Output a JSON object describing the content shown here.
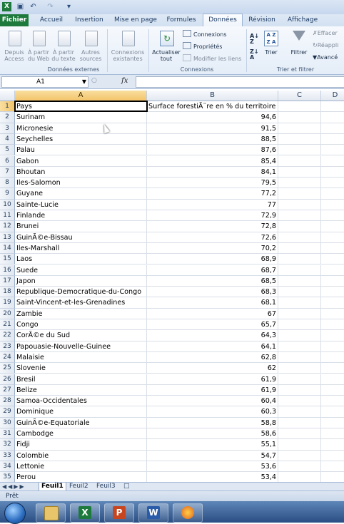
{
  "titlebar": {
    "undo_icon": "undo-icon",
    "redo_icon": "redo-icon"
  },
  "tabs": [
    {
      "label": "Fichier"
    },
    {
      "label": "Accueil"
    },
    {
      "label": "Insertion"
    },
    {
      "label": "Mise en page"
    },
    {
      "label": "Formules"
    },
    {
      "label": "Données"
    },
    {
      "label": "Révision"
    },
    {
      "label": "Affichage"
    }
  ],
  "ribbon": {
    "external_data": {
      "group": "Données externes",
      "buttons": [
        {
          "label": "Depuis\nAccess"
        },
        {
          "label": "À partir\ndu Web"
        },
        {
          "label": "À partir\ndu texte"
        },
        {
          "label": "Autres\nsources"
        },
        {
          "label": "Connexions\nexistantes"
        }
      ]
    },
    "connections": {
      "group": "Connexions",
      "refresh": "Actualiser\ntout",
      "links": [
        "Connexions",
        "Propriétés",
        "Modifier les liens"
      ]
    },
    "sort_filter": {
      "group": "Trier et filtrer",
      "sort": "Trier",
      "filter": "Filtrer",
      "side": [
        "Effacer",
        "Réappli",
        "Avancé"
      ]
    }
  },
  "formula_bar": {
    "cell_ref": "A1",
    "fx": "fx",
    "value": ""
  },
  "columns": [
    "A",
    "B",
    "C",
    "D"
  ],
  "header_row": {
    "a": "Pays",
    "b": "Surface forestiÃ¨re en % du territoire"
  },
  "rows": [
    {
      "n": "2",
      "a": "Surinam",
      "b": "94,6"
    },
    {
      "n": "3",
      "a": "Micronesie",
      "b": "91,5"
    },
    {
      "n": "4",
      "a": "Seychelles",
      "b": "88,5"
    },
    {
      "n": "5",
      "a": "Palau",
      "b": "87,6"
    },
    {
      "n": "6",
      "a": "Gabon",
      "b": "85,4"
    },
    {
      "n": "7",
      "a": "Bhoutan",
      "b": "84,1"
    },
    {
      "n": "8",
      "a": "Iles-Salomon",
      "b": "79,5"
    },
    {
      "n": "9",
      "a": "Guyane",
      "b": "77,2"
    },
    {
      "n": "10",
      "a": "Sainte-Lucie",
      "b": "77"
    },
    {
      "n": "11",
      "a": "Finlande",
      "b": "72,9"
    },
    {
      "n": "12",
      "a": "Brunei",
      "b": "72,8"
    },
    {
      "n": "13",
      "a": "GuinÃ©e-Bissau",
      "b": "72,6"
    },
    {
      "n": "14",
      "a": "Iles-Marshall",
      "b": "70,2"
    },
    {
      "n": "15",
      "a": "Laos",
      "b": "68,9"
    },
    {
      "n": "16",
      "a": "Suede",
      "b": "68,7"
    },
    {
      "n": "17",
      "a": "Japon",
      "b": "68,5"
    },
    {
      "n": "18",
      "a": "Republique-Democratique-du-Congo",
      "b": "68,3"
    },
    {
      "n": "19",
      "a": "Saint-Vincent-et-les-Grenadines",
      "b": "68,1"
    },
    {
      "n": "20",
      "a": "Zambie",
      "b": "67"
    },
    {
      "n": "21",
      "a": "Congo",
      "b": "65,7"
    },
    {
      "n": "22",
      "a": "CorÃ©e du Sud",
      "b": "64,3"
    },
    {
      "n": "23",
      "a": "Papouasie-Nouvelle-Guinee",
      "b": "64,1"
    },
    {
      "n": "24",
      "a": "Malaisie",
      "b": "62,8"
    },
    {
      "n": "25",
      "a": "Slovenie",
      "b": "62"
    },
    {
      "n": "26",
      "a": "Bresil",
      "b": "61,9"
    },
    {
      "n": "27",
      "a": "Belize",
      "b": "61,9"
    },
    {
      "n": "28",
      "a": "Samoa-Occidentales",
      "b": "60,4"
    },
    {
      "n": "29",
      "a": "Dominique",
      "b": "60,3"
    },
    {
      "n": "30",
      "a": "GuinÃ©e-Equatoriale",
      "b": "58,8"
    },
    {
      "n": "31",
      "a": "Cambodge",
      "b": "58,6"
    },
    {
      "n": "32",
      "a": "Fidji",
      "b": "55,1"
    },
    {
      "n": "33",
      "a": "Colombie",
      "b": "54,7"
    },
    {
      "n": "34",
      "a": "Lettonie",
      "b": "53,6"
    },
    {
      "n": "35",
      "a": "Perou",
      "b": "53,4"
    }
  ],
  "sheets": [
    "Feuil1",
    "Feuil2",
    "Feuil3"
  ],
  "status": "Prêt",
  "taskbar": [
    "windows-start-icon",
    "explorer-icon",
    "excel-icon",
    "powerpoint-icon",
    "word-icon",
    "firefox-icon"
  ],
  "colors": {
    "file_tab": "#1e7a3c",
    "selection_header": "#f3c46a",
    "taskbar": "#2a4e83"
  }
}
